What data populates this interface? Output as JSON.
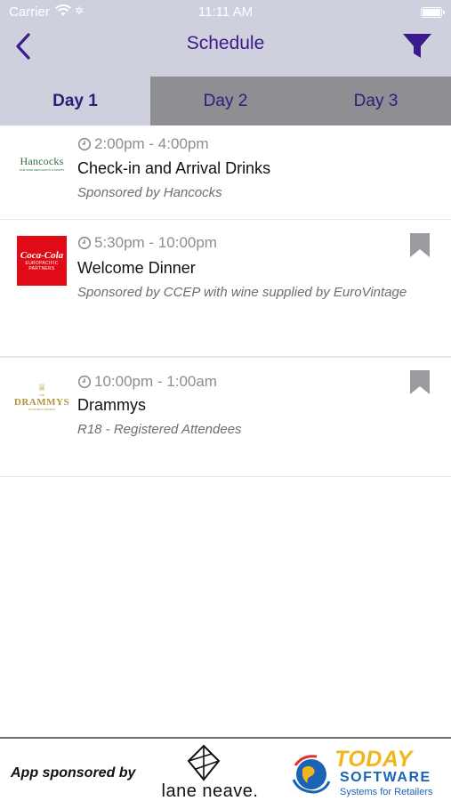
{
  "status_bar": {
    "carrier": "Carrier",
    "time": "11:11 AM"
  },
  "nav": {
    "title": "Schedule",
    "back_icon": "chevron-left-icon",
    "filter_icon": "funnel-icon"
  },
  "tabs": [
    {
      "label": "Day 1",
      "active": true
    },
    {
      "label": "Day 2",
      "active": false
    },
    {
      "label": "Day 3",
      "active": false
    }
  ],
  "events": [
    {
      "time": "2:00pm - 4:00pm",
      "title": "Check-in and Arrival Drinks",
      "subtitle": "Sponsored by Hancocks",
      "logo": {
        "name": "Hancocks",
        "tagline": "FINE WINE MERCHANTS & SPIRITS"
      },
      "bookmark": false
    },
    {
      "time": "5:30pm - 10:00pm",
      "title": "Welcome Dinner",
      "subtitle": "Sponsored by CCEP with wine supplied by EuroVintage",
      "logo": {
        "name": "Coca-Cola",
        "line1": "EUROPACIFIC",
        "line2": "PARTNERS"
      },
      "bookmark": true
    },
    {
      "time": "10:00pm - 1:00am",
      "title": "Drammys",
      "subtitle": "R18 - Registered Attendees",
      "logo": {
        "name": "DRAMMYS",
        "top": "THE",
        "tagline": "NZ WHISKY AWARDS"
      },
      "bookmark": true
    }
  ],
  "footer": {
    "label": "App sponsored by",
    "sponsor1": {
      "name": "lane neave."
    },
    "sponsor2": {
      "title": "TODAY",
      "sub": "SOFTWARE",
      "tagline": "Systems for Retailers"
    }
  },
  "colors": {
    "nav_bg": "#cfd0de",
    "accent": "#3a1a8c",
    "tab_inactive": "#8e8e93",
    "ccep_red": "#e00b16",
    "today_yellow": "#f2b61c",
    "today_blue": "#1a64b5"
  }
}
